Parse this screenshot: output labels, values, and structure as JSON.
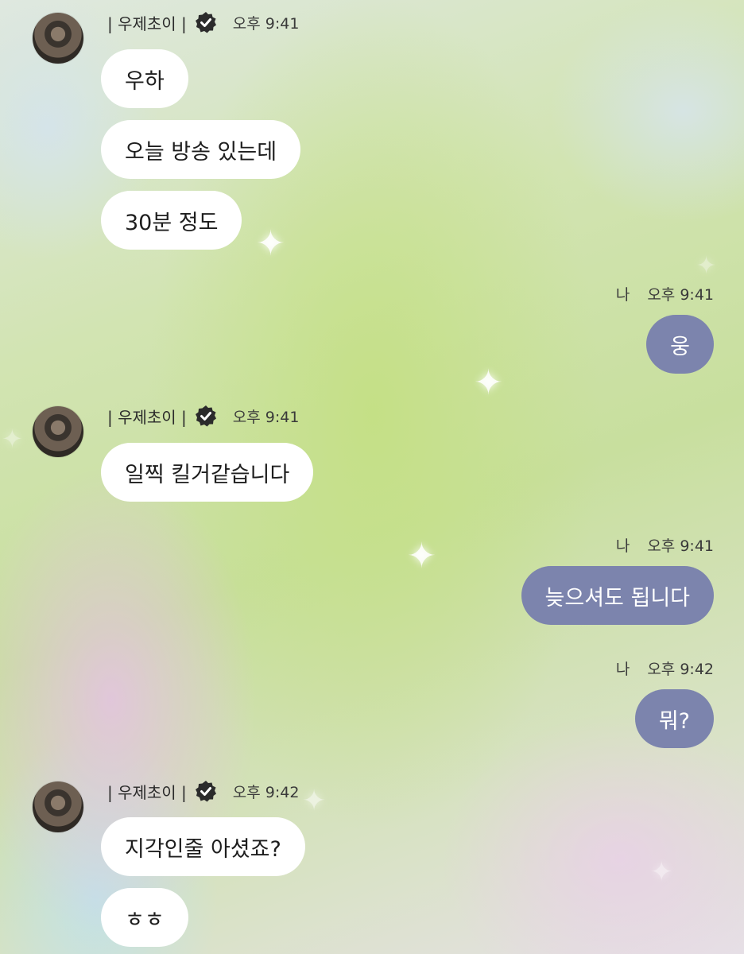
{
  "sender": {
    "name": "| 우제초이 |",
    "verified_icon": "verified-check-icon"
  },
  "me_label": "나",
  "colors": {
    "incoming_bubble": "#ffffff",
    "outgoing_bubble": "#7c84ad"
  },
  "groups": [
    {
      "time": "오후 9:41",
      "messages": [
        "우하",
        "오늘 방송 있는데",
        "30분 정도"
      ]
    },
    {
      "time": "오후 9:41",
      "messages": [
        "일찍 킬거같습니다"
      ]
    },
    {
      "time": "오후 9:42",
      "messages": [
        "지각인줄 아셨죠?",
        "ㅎㅎ"
      ]
    }
  ],
  "replies": [
    {
      "time": "오후 9:41",
      "message": "웅"
    },
    {
      "time": "오후 9:41",
      "message": "늦으셔도 됩니다"
    },
    {
      "time": "오후 9:42",
      "message": "뭐?"
    }
  ]
}
